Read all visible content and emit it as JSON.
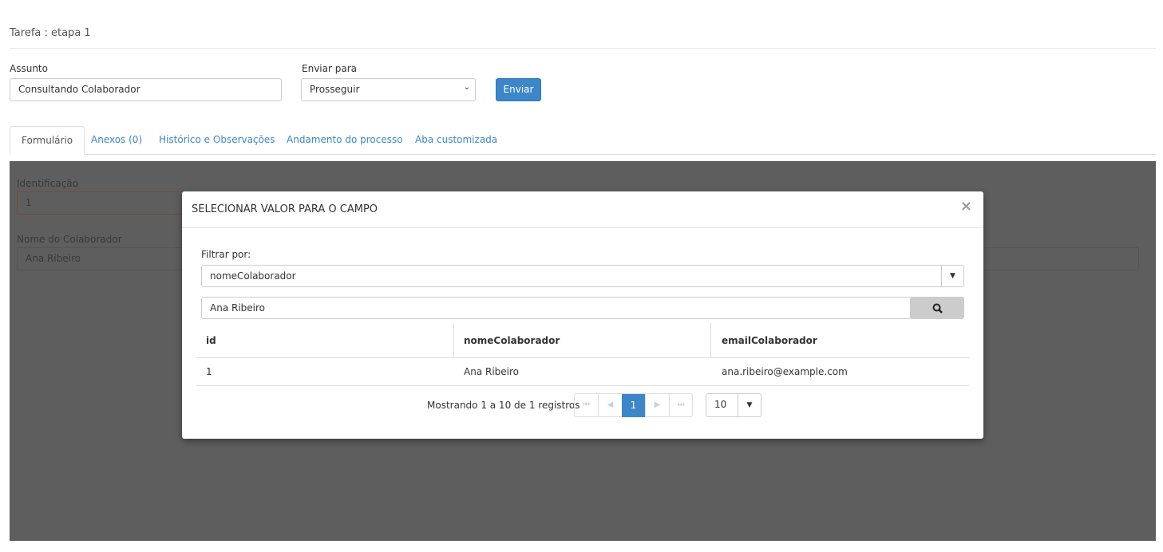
{
  "header": {
    "title": "Tarefa : etapa 1"
  },
  "form": {
    "subject_label": "Assunto",
    "subject_value": "Consultando Colaborador",
    "send_to_label": "Enviar para",
    "send_to_value": "Prosseguir",
    "send_button": "Enviar"
  },
  "tabs": [
    {
      "label": "Formulário"
    },
    {
      "label": "Anexos (0)"
    },
    {
      "label": "Histórico e Observações"
    },
    {
      "label": "Andamento do processo"
    },
    {
      "label": "Aba customizada"
    }
  ],
  "background_form": {
    "id_label": "Identificação",
    "id_value": "1",
    "name_label": "Nome do Colaborador",
    "name_value": "Ana Ribeiro"
  },
  "modal": {
    "title": "SELECIONAR VALOR PARA O CAMPO",
    "close": "×",
    "filter_label": "Filtrar por:",
    "filter_value": "nomeColaborador",
    "search_value": "Ana Ribeiro",
    "columns": [
      "id",
      "nomeColaborador",
      "emailColaborador"
    ],
    "rows": [
      [
        "1",
        "Ana Ribeiro",
        "ana.ribeiro@example.com"
      ]
    ],
    "info": "Mostrando 1 a 10 de 1 registros",
    "current_page": "1",
    "page_size": "10"
  }
}
